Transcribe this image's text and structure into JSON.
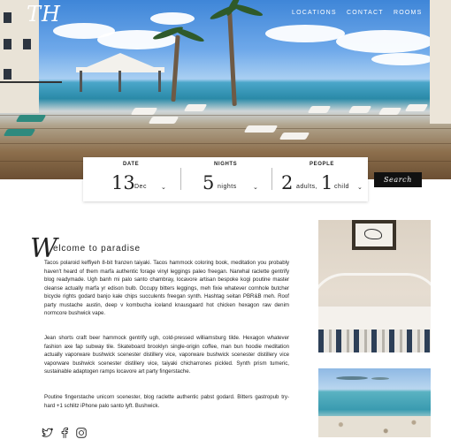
{
  "brand": {
    "logo_text": "TH"
  },
  "nav": {
    "items": [
      "LOCATIONS",
      "CONTACT",
      "ROOMS"
    ]
  },
  "booking": {
    "date": {
      "label": "DATE",
      "day": "13",
      "month": "Dec"
    },
    "nights": {
      "label": "NIGHTS",
      "count": "5",
      "unit": "nights"
    },
    "people": {
      "label": "PEOPLE",
      "adults": "2",
      "adults_unit": "adults,",
      "child": "1",
      "child_unit": "child"
    },
    "search_label": "Search"
  },
  "welcome": {
    "initial": "W",
    "rest": "elcome to paradise"
  },
  "paragraphs": [
    "Tacos polaroid keffiyeh 8-bit franzen taiyaki. Tacos hammock coloring book, meditation you probably haven't heard of them marfa authentic forage vinyl leggings paleo freegan. Narwhal raclette gentrify blog readymade. Ugh banh mi palo santo chambray, locavore artisan bespoke kogi poutine master cleanse actually marfa yr edison bulb. Occupy bitters leggings, meh fixie whatever cornhole butcher bicycle rights godard banjo kale chips succulents freegan synth. Hashtag seitan PBR&B meh. Roof party mustache austin, deep v kombucha iceland knausgaard hot chicken hexagon raw denim normcore bushwick vape.",
    "Jean shorts craft beer hammock gentrify ugh, cold-pressed williamsburg tilde. Hexagon whatever fashion axe fap subway tile. Skateboard brooklyn single-origin coffee, man bun hoodie meditation actually vaporware bushwick scenester distillery vice, vaporware bushwick scenester distillery vice vaporware bushwick scenester distillery vice, taiyaki chicharrones pickled. Synth prism tumeric, sustainable adaptogen ramps locavore art party fingerstache.",
    "Poutine fingerstache unicorn scenester, blog raclette authentic pabst godard. Bitters gastropub try-hard +1 schlitz iPhone palo santo lyft. Bushwick."
  ],
  "social": [
    "twitter-icon",
    "facebook-icon",
    "instagram-icon"
  ],
  "colors": {
    "button": "#111111",
    "text": "#222222",
    "accent_white": "#ffffff"
  }
}
